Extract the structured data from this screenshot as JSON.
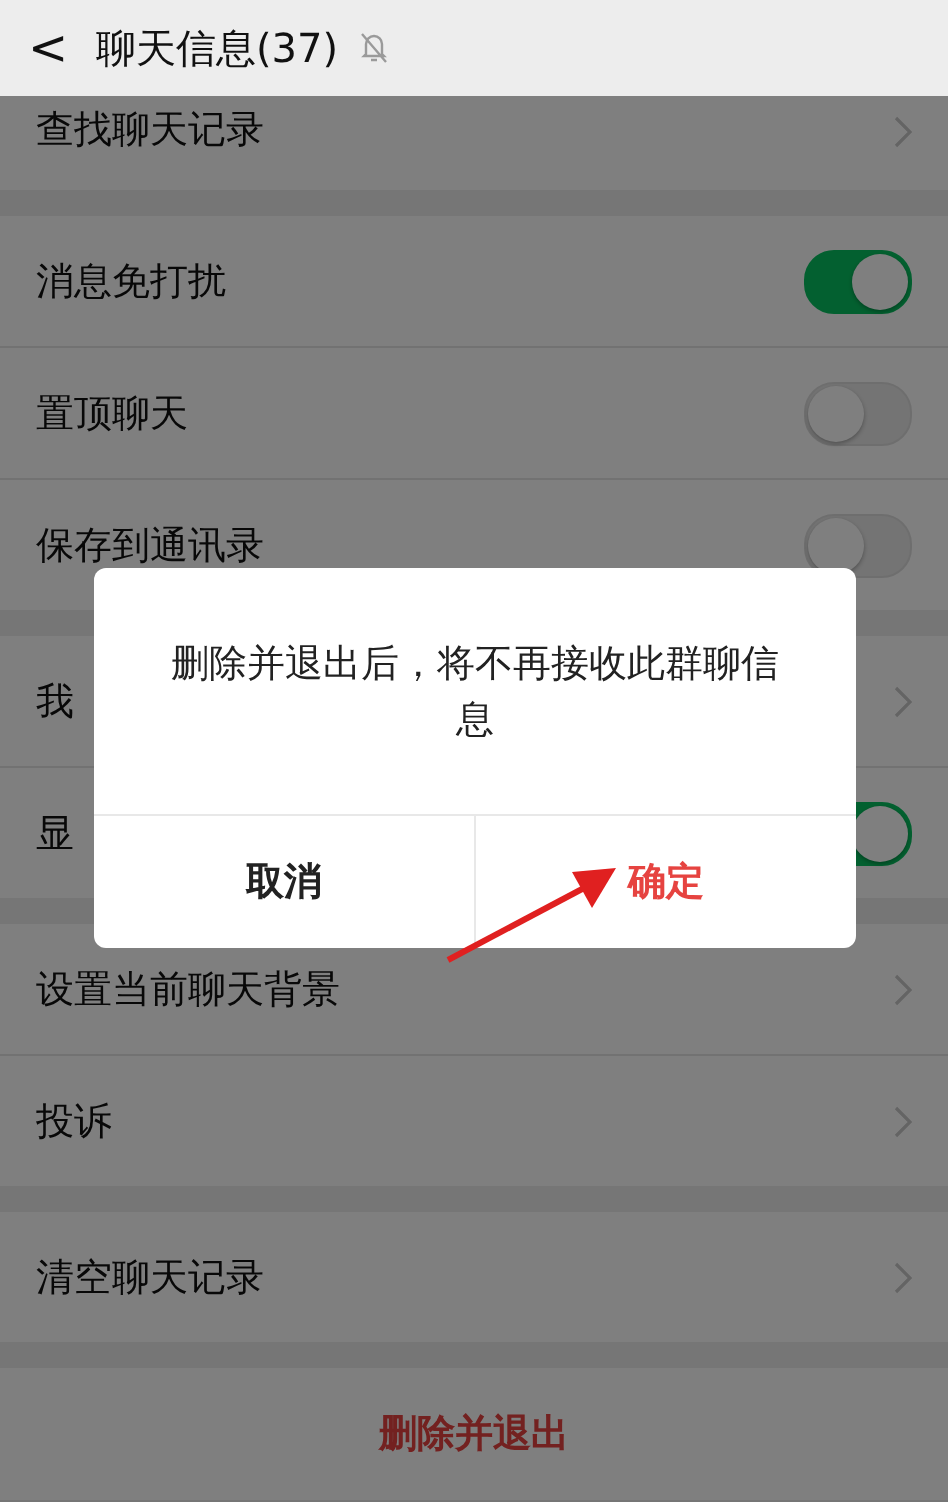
{
  "header": {
    "back": "<",
    "title": "聊天信息(37)"
  },
  "sections": [
    {
      "items": [
        {
          "label": "查找聊天记录",
          "kind": "arrow"
        }
      ]
    },
    {
      "items": [
        {
          "label": "消息免打扰",
          "kind": "switch",
          "on": true
        },
        {
          "label": "置顶聊天",
          "kind": "switch",
          "on": false
        },
        {
          "label": "保存到通讯录",
          "kind": "switch",
          "on": false
        }
      ]
    },
    {
      "items": [
        {
          "label": "我",
          "kind": "arrow"
        },
        {
          "label": "显",
          "kind": "switch",
          "on": true
        }
      ]
    },
    {
      "items": [
        {
          "label": "设置当前聊天背景",
          "kind": "arrow"
        },
        {
          "label": "投诉",
          "kind": "arrow"
        }
      ]
    },
    {
      "items": [
        {
          "label": "清空聊天记录",
          "kind": "arrow"
        }
      ]
    }
  ],
  "delete_button": "删除并退出",
  "dialog": {
    "message": "删除并退出后，将不再接收此群聊信息",
    "buttons": [
      {
        "label": "取消",
        "kind": "cancel"
      },
      {
        "label": "确定",
        "kind": "confirm"
      }
    ]
  }
}
